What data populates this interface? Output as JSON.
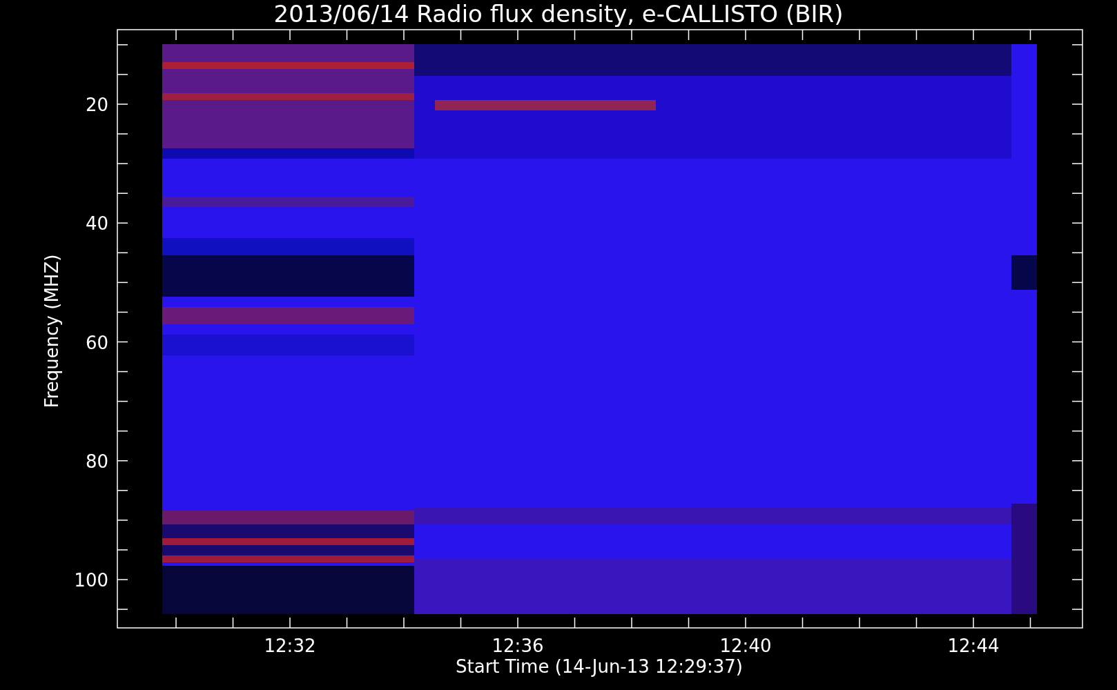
{
  "title": "2013/06/14  Radio flux density, e-CALLISTO (BIR)",
  "y_axis": {
    "label": "Frequency (MHZ)",
    "tick_labels": [
      "20",
      "40",
      "60",
      "80",
      "100"
    ]
  },
  "x_axis": {
    "label": "Start Time (14-Jun-13 12:29:37)",
    "tick_labels": [
      "12:32",
      "12:36",
      "12:40",
      "12:44"
    ]
  }
}
